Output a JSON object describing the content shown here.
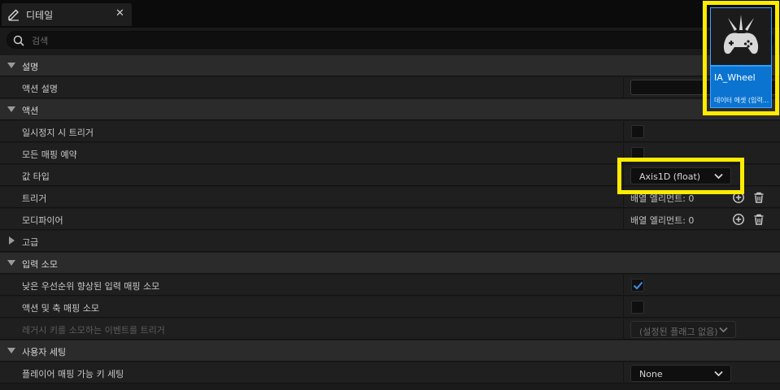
{
  "tab": {
    "title": "디테일",
    "close_glyph": "✕"
  },
  "search": {
    "placeholder": "검색"
  },
  "sections": {
    "description": {
      "header": "설명",
      "action_description_label": "액션 설명",
      "action_description_value": ""
    },
    "action": {
      "header": "액션",
      "trigger_when_paused_label": "일시정지 시 트리거",
      "trigger_when_paused_checked": false,
      "reserve_all_mappings_label": "모든 매핑 예약",
      "reserve_all_mappings_checked": false,
      "value_type_label": "값 타입",
      "value_type_value": "Axis1D (float)",
      "triggers_label": "트리거",
      "triggers_value": "배열 엘리먼트: 0",
      "modifiers_label": "모디파이어",
      "modifiers_value": "배열 엘리먼트: 0"
    },
    "advanced": {
      "header": "고급"
    },
    "input_consumption": {
      "header": "입력 소모",
      "consume_lower_priority_label": "낮은 우선순위 향상된 입력 매핑 소모",
      "consume_lower_priority_checked": true,
      "consume_action_axis_label": "액션 및 축 매핑 소모",
      "consume_action_axis_checked": false,
      "legacy_keys_label": "레거시 키를 소모하는 이벤트를 트리거",
      "legacy_keys_value": "(설정된 플래그 없음)"
    },
    "user_settings": {
      "header": "사용자 세팅",
      "player_mappable_label": "플레이어 매핑 가능 키 세팅",
      "player_mappable_value": "None"
    }
  },
  "asset_thumbnail": {
    "name": "IA_Wheel",
    "type": "데이터 에셋 (입력..."
  },
  "colors": {
    "highlight": "#ffeb00",
    "accent": "#0b74d0",
    "check": "#3d8fe6"
  },
  "icons": [
    "edit-pencil-icon",
    "search-icon",
    "add-circle-icon",
    "trash-icon",
    "gamepad-icon",
    "chevron-down-icon",
    "checkmark-icon"
  ]
}
